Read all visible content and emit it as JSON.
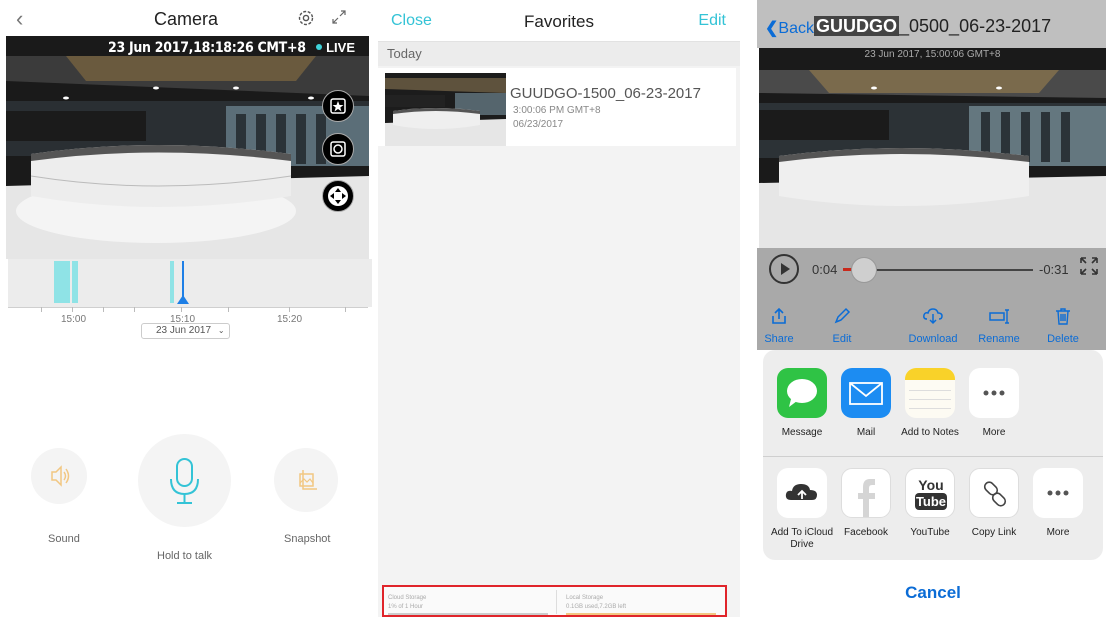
{
  "camera": {
    "title": "Camera",
    "timestamp": "23 Jun 2017,18:18:26 CMT+8",
    "live_label": "LIVE",
    "timeline_labels": [
      "15:00",
      "15:10",
      "15:20"
    ],
    "date_picker": "23 Jun 2017",
    "controls": {
      "sound": "Sound",
      "talk": "Hold to talk",
      "snapshot": "Snapshot"
    },
    "accent_color": "#3fd3d9"
  },
  "favorites": {
    "close": "Close",
    "title": "Favorites",
    "edit": "Edit",
    "section": "Today",
    "items": [
      {
        "title": "GUUDGO-1500_06-23-2017",
        "time": "3:00:06 PM GMT+8",
        "date": "06/23/2017"
      }
    ],
    "storage": {
      "cloud_label": "Cloud Storage",
      "cloud_value": "1% of 1 Hour",
      "local_label": "Local Storage",
      "local_value": "0.1GB used,7.2GB left"
    },
    "highlight_color": "#e0242a"
  },
  "clip": {
    "back": "Back",
    "title_highlight": "GUUDGO",
    "title_rest": "_0500_06-23-2017",
    "timestamp": "23 Jun 2017, 15:00:06 GMT+8",
    "elapsed": "0:04",
    "remaining": "-0:31",
    "playback_progress": 0.11,
    "actions": [
      "Share",
      "Edit",
      "Download",
      "Rename",
      "Delete"
    ],
    "share_row1": [
      "Message",
      "Mail",
      "Add to Notes",
      "More"
    ],
    "share_row2": [
      "Add To iCloud Drive",
      "Facebook",
      "YouTube",
      "Copy Link",
      "More"
    ],
    "cancel": "Cancel",
    "link_color": "#0b6cd6"
  }
}
